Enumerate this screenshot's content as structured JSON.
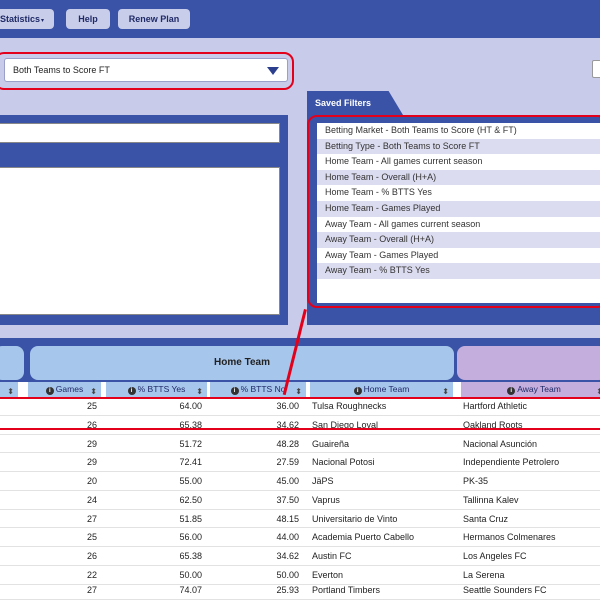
{
  "nav": {
    "statistics_label": "Statistics",
    "help_label": "Help",
    "renew_label": "Renew Plan"
  },
  "market_select": {
    "value": "Both Teams to Score FT"
  },
  "saved_filters": {
    "title": "Saved Filters",
    "items": [
      "Betting Market - Both Teams to Score (HT & FT)",
      "Betting Type - Both Teams to Score FT",
      "Home Team - All games current season",
      "Home Team - Overall (H+A)",
      "Home Team - % BTTS Yes",
      "Home Team - Games Played",
      "Away Team - All games current season",
      "Away Team - Overall (H+A)",
      "Away Team - Games Played",
      "Away Team - % BTTS Yes"
    ]
  },
  "table": {
    "group_home": "Home Team",
    "columns": {
      "games": "Games",
      "btts_yes": "% BTTS Yes",
      "btts_no": "% BTTS No",
      "home_team": "Home Team",
      "away_team": "Away Team"
    },
    "rows": [
      {
        "games": "25",
        "yes": "64.00",
        "no": "36.00",
        "home": "Tulsa Roughnecks",
        "away": "Hartford Athletic"
      },
      {
        "games": "26",
        "yes": "65.38",
        "no": "34.62",
        "home": "San Diego Loyal",
        "away": "Oakland Roots"
      },
      {
        "games": "29",
        "yes": "51.72",
        "no": "48.28",
        "home": "Guaireña",
        "away": "Nacional Asunción"
      },
      {
        "games": "29",
        "yes": "72.41",
        "no": "27.59",
        "home": "Nacional Potosi",
        "away": "Independiente Petrolero"
      },
      {
        "games": "20",
        "yes": "55.00",
        "no": "45.00",
        "home": "JäPS",
        "away": "PK-35"
      },
      {
        "games": "24",
        "yes": "62.50",
        "no": "37.50",
        "home": "Vaprus",
        "away": "Tallinna Kalev"
      },
      {
        "games": "27",
        "yes": "51.85",
        "no": "48.15",
        "home": "Universitario de Vinto",
        "away": "Santa Cruz"
      },
      {
        "games": "25",
        "yes": "56.00",
        "no": "44.00",
        "home": "Academia Puerto Cabello",
        "away": "Hermanos Colmenares"
      },
      {
        "games": "26",
        "yes": "65.38",
        "no": "34.62",
        "home": "Austin FC",
        "away": "Los Angeles FC"
      },
      {
        "games": "22",
        "yes": "50.00",
        "no": "50.00",
        "home": "Everton",
        "away": "La Serena"
      },
      {
        "games": "27",
        "yes": "74.07",
        "no": "25.93",
        "home": "Portland Timbers",
        "away": "Seattle Sounders FC"
      }
    ]
  },
  "colors": {
    "primary": "#3b53a6",
    "panel": "#c9cbeb",
    "home_group": "#a7c6ec",
    "away_group": "#c3aedd",
    "highlight": "#e3001b"
  }
}
